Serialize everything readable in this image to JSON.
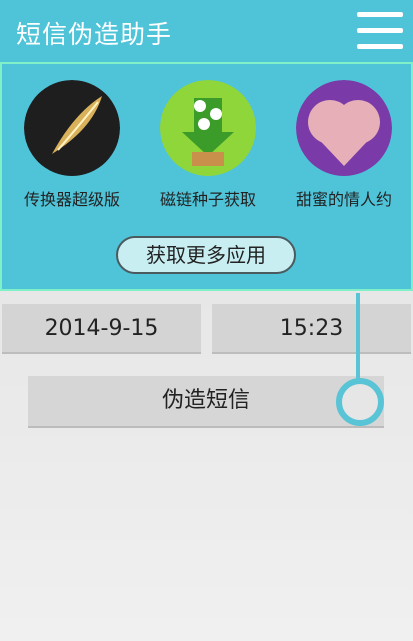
{
  "app": {
    "title": "短信伪造助手"
  },
  "promo": {
    "apps": [
      {
        "label": "传换器超级版",
        "icon": "feather-icon"
      },
      {
        "label": "磁链种子获取",
        "icon": "download-box-icon"
      },
      {
        "label": "甜蜜的情人约",
        "icon": "heart-icon"
      }
    ],
    "more_label": "获取更多应用"
  },
  "form": {
    "date": "2014-9-15",
    "time": "15:23"
  },
  "action": {
    "forge_label": "伪造短信"
  },
  "colors": {
    "accent": "#4fc3d8",
    "promo_border": "#7ff0c8"
  }
}
